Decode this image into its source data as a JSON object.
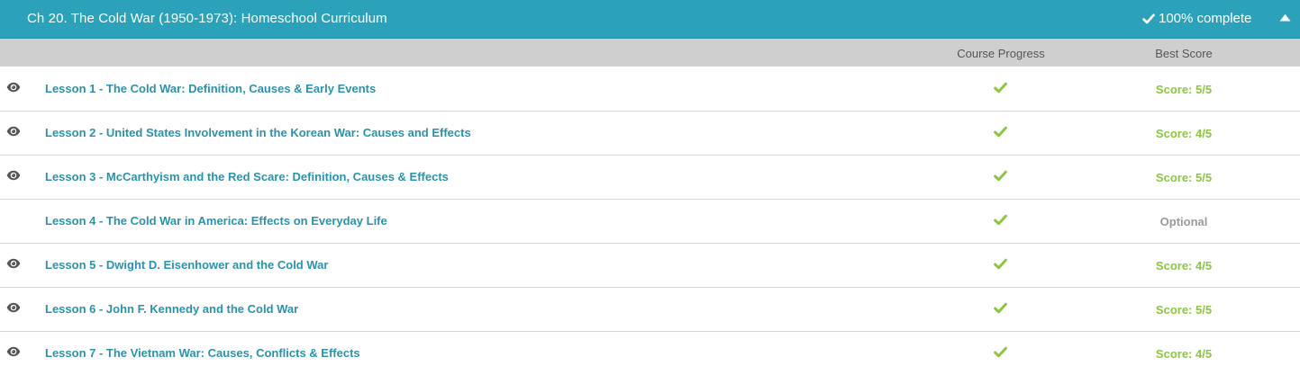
{
  "chapter": {
    "title": "Ch 20. The Cold War (1950-1973): Homeschool Curriculum",
    "completion": "100% complete",
    "completion_icon": "check-icon",
    "collapse_icon": "caret-up-icon",
    "header_color": "#2ba2ba"
  },
  "columns": {
    "progress": "Course Progress",
    "score": "Best Score"
  },
  "colors": {
    "link": "#2a93ab",
    "check": "#8dc63f",
    "score": "#8dc63f",
    "optional": "#9a9a9a"
  },
  "lessons": [
    {
      "title": "Lesson 1 - The Cold War: Definition, Causes & Early Events",
      "has_video_icon": true,
      "complete": true,
      "score": "Score: 5/5",
      "optional": false
    },
    {
      "title": "Lesson 2 - United States Involvement in the Korean War: Causes and Effects",
      "has_video_icon": true,
      "complete": true,
      "score": "Score: 4/5",
      "optional": false
    },
    {
      "title": "Lesson 3 - McCarthyism and the Red Scare: Definition, Causes & Effects",
      "has_video_icon": true,
      "complete": true,
      "score": "Score: 5/5",
      "optional": false
    },
    {
      "title": "Lesson 4 - The Cold War in America: Effects on Everyday Life",
      "has_video_icon": false,
      "complete": true,
      "score": "Optional",
      "optional": true
    },
    {
      "title": "Lesson 5 - Dwight D. Eisenhower and the Cold War",
      "has_video_icon": true,
      "complete": true,
      "score": "Score: 4/5",
      "optional": false
    },
    {
      "title": "Lesson 6 - John F. Kennedy and the Cold War",
      "has_video_icon": true,
      "complete": true,
      "score": "Score: 5/5",
      "optional": false
    },
    {
      "title": "Lesson 7 - The Vietnam War: Causes, Conflicts & Effects",
      "has_video_icon": true,
      "complete": true,
      "score": "Score: 4/5",
      "optional": false
    }
  ]
}
